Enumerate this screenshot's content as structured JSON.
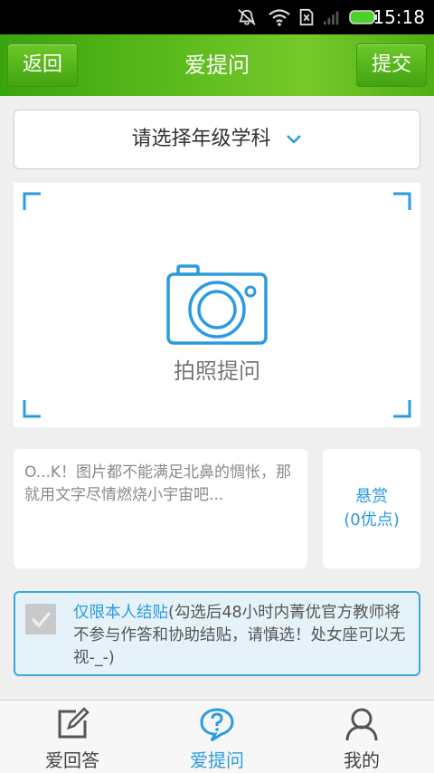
{
  "status_bar": {
    "time": "15:18"
  },
  "header": {
    "back_label": "返回",
    "title": "爱提问",
    "submit_label": "提交"
  },
  "grade_select": {
    "label": "请选择年级学科",
    "icon": "chevron-down-icon"
  },
  "photo": {
    "label": "拍照提问",
    "icon": "camera-icon"
  },
  "question": {
    "placeholder": "O...K！图片都不能满足北鼻的惆怅，那就用文字尽情燃烧小宇宙吧..."
  },
  "reward": {
    "line1": "悬赏",
    "line2": "(0优点)"
  },
  "private_notice": {
    "highlight": "仅限本人结贴",
    "text": "(勾选后48小时内菁优官方教师将不参与作答和协助结贴，请慎选！处女座可以无视-_-)"
  },
  "nav": [
    {
      "label": "爱回答",
      "icon": "edit-icon",
      "active": false
    },
    {
      "label": "爱提问",
      "icon": "question-bubble-icon",
      "active": true
    },
    {
      "label": "我的",
      "icon": "user-icon",
      "active": false
    }
  ],
  "colors": {
    "accent": "#2b9be0",
    "header_green": "#5fbd1e",
    "background": "#efefef"
  }
}
